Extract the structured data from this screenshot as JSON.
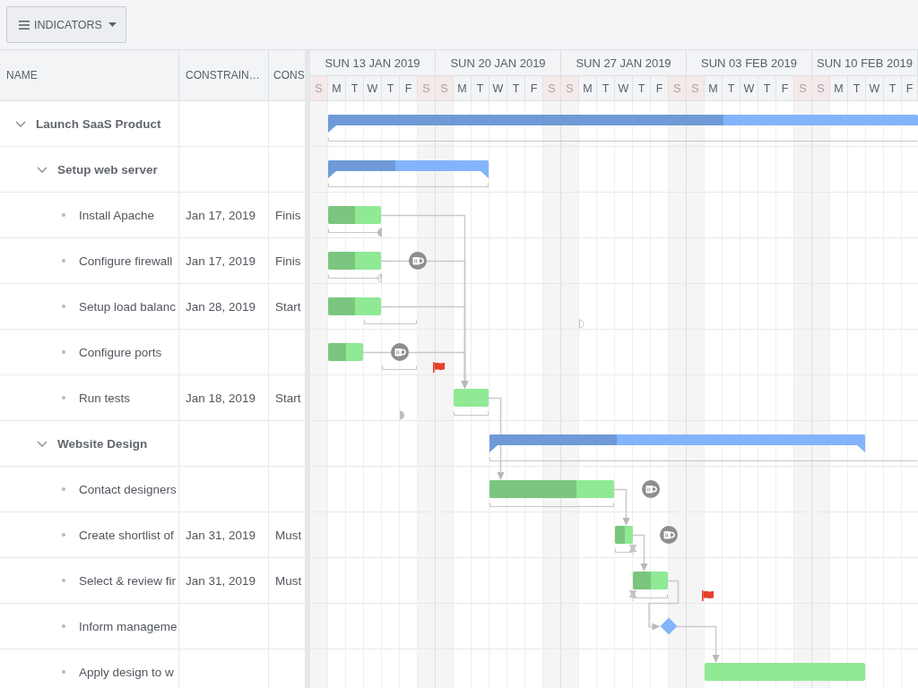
{
  "toolbar": {
    "button": {
      "label": "INDICATORS"
    }
  },
  "columns": [
    {
      "label": "NAME"
    },
    {
      "label": "CONSTRAIN…"
    },
    {
      "label": "CONS"
    }
  ],
  "timeline": {
    "weeks": [
      {
        "label": "SUN 13 JAN 2019",
        "days": [
          {
            "letter": "S",
            "weekend": true
          },
          {
            "letter": "M",
            "weekend": false
          },
          {
            "letter": "T",
            "weekend": false
          },
          {
            "letter": "W",
            "weekend": false
          },
          {
            "letter": "T",
            "weekend": false
          },
          {
            "letter": "F",
            "weekend": false
          },
          {
            "letter": "S",
            "weekend": true
          }
        ]
      },
      {
        "label": "SUN 20 JAN 2019",
        "days": [
          {
            "letter": "S",
            "weekend": true
          },
          {
            "letter": "M",
            "weekend": false
          },
          {
            "letter": "T",
            "weekend": false
          },
          {
            "letter": "W",
            "weekend": false
          },
          {
            "letter": "T",
            "weekend": false
          },
          {
            "letter": "F",
            "weekend": false
          },
          {
            "letter": "S",
            "weekend": true
          }
        ]
      },
      {
        "label": "SUN 27 JAN 2019",
        "days": [
          {
            "letter": "S",
            "weekend": true
          },
          {
            "letter": "M",
            "weekend": false
          },
          {
            "letter": "T",
            "weekend": false
          },
          {
            "letter": "W",
            "weekend": false
          },
          {
            "letter": "T",
            "weekend": false
          },
          {
            "letter": "F",
            "weekend": false
          },
          {
            "letter": "S",
            "weekend": true
          }
        ]
      },
      {
        "label": "SUN 03 FEB 2019",
        "days": [
          {
            "letter": "S",
            "weekend": true
          },
          {
            "letter": "M",
            "weekend": false
          },
          {
            "letter": "T",
            "weekend": false
          },
          {
            "letter": "W",
            "weekend": false
          },
          {
            "letter": "T",
            "weekend": false
          },
          {
            "letter": "F",
            "weekend": false
          },
          {
            "letter": "S",
            "weekend": true
          }
        ]
      },
      {
        "label": "SUN 10 FEB 2019",
        "days": [
          {
            "letter": "S",
            "weekend": true
          },
          {
            "letter": "M",
            "weekend": false
          },
          {
            "letter": "T",
            "weekend": false
          },
          {
            "letter": "W",
            "weekend": false
          },
          {
            "letter": "T",
            "weekend": false
          },
          {
            "letter": "F",
            "weekend": false
          }
        ]
      }
    ]
  },
  "tasks": [
    {
      "name": "Launch SaaS Product",
      "expanded": true,
      "bar": {
        "kind": "summary",
        "level": 0.67
      },
      "children": [
        {
          "name": "Setup web server",
          "expanded": true,
          "bar": {
            "kind": "summary",
            "level": 0.42
          },
          "children": [
            {
              "name": "Install Apache",
              "constraint_date": "Jan 17, 2019",
              "constraint_type": "Finis",
              "bar": {
                "kind": "task",
                "level": 0.5
              }
            },
            {
              "name": "Configure firewall",
              "constraint_date": "Jan 17, 2019",
              "constraint_type": "Finis",
              "bar": {
                "kind": "task",
                "level": 0.5
              }
            },
            {
              "name": "Setup load balanc",
              "constraint_date": "Jan 28, 2019",
              "constraint_type": "Start",
              "bar": {
                "kind": "task",
                "level": 0.5
              }
            },
            {
              "name": "Configure ports",
              "bar": {
                "kind": "task",
                "level": 0.5
              }
            },
            {
              "name": "Run tests",
              "constraint_date": "Jan 18, 2019",
              "constraint_type": "Start",
              "bar": {
                "kind": "task"
              }
            }
          ]
        },
        {
          "name": "Website Design",
          "expanded": true,
          "bar": {
            "kind": "summary",
            "level": 0.34
          },
          "children": [
            {
              "name": "Contact designers",
              "bar": {
                "kind": "task",
                "level": 0.7
              }
            },
            {
              "name": "Create shortlist of",
              "constraint_date": "Jan 31, 2019",
              "constraint_type": "Must",
              "bar": {
                "kind": "task",
                "level": 0.55
              }
            },
            {
              "name": "Select & review fir",
              "constraint_date": "Jan 31, 2019",
              "constraint_type": "Must",
              "bar": {
                "kind": "task",
                "level": 0.5
              }
            },
            {
              "name": "Inform manageme",
              "bar": {
                "kind": "milestone"
              }
            },
            {
              "name": "Apply design to w",
              "bar": {
                "kind": "task"
              }
            }
          ]
        }
      ]
    }
  ]
}
